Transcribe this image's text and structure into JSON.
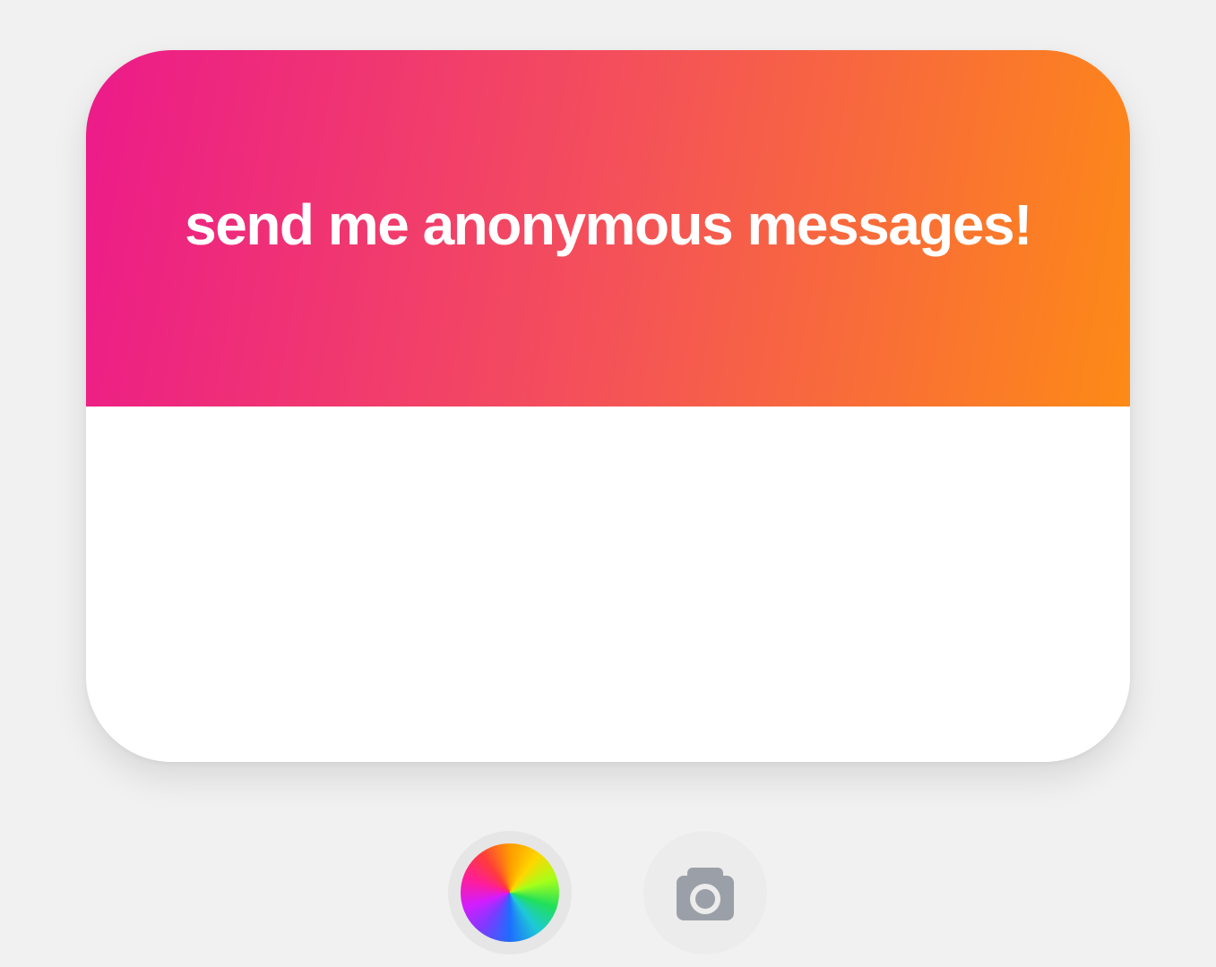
{
  "card": {
    "title": "send me anonymous messages!",
    "gradient": [
      "#ec1a8a",
      "#f4505a",
      "#fd8a16"
    ],
    "body_color": "#ffffff"
  },
  "controls": {
    "color_wheel_icon": "color-wheel-icon",
    "camera_icon": "camera-icon",
    "camera_icon_color": "#9ba0a8"
  },
  "background_color": "#f1f1f1"
}
